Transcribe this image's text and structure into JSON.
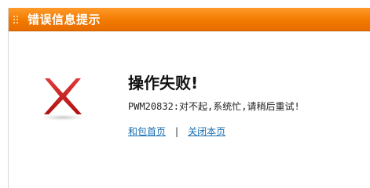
{
  "titlebar": {
    "title": "错误信息提示",
    "color": "#f27a00"
  },
  "error": {
    "icon": "red-x-icon",
    "icon_color": "#cc1f1f",
    "heading": "操作失败!",
    "message": "PWM20832:对不起,系统忙,请稍后重试!"
  },
  "links": {
    "home_label": "和包首页",
    "separator": "|",
    "close_label": "关闭本页",
    "link_color": "#1a6fb3"
  }
}
